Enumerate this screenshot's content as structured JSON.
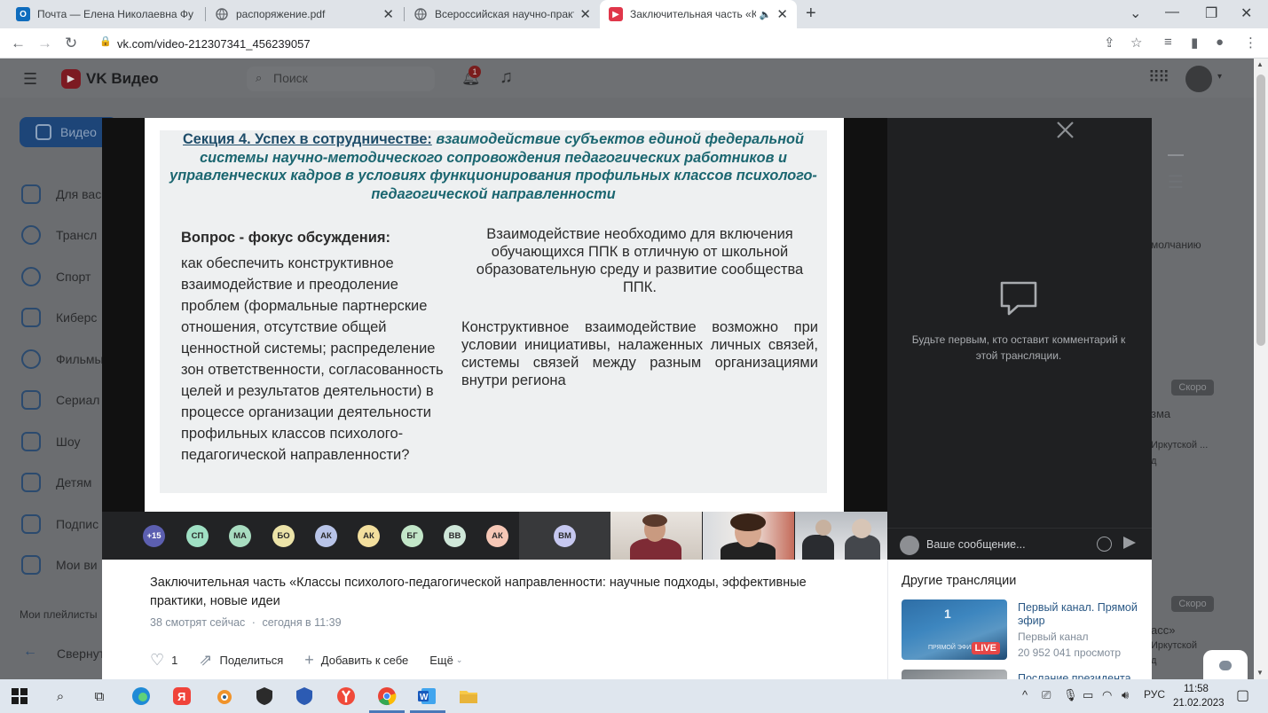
{
  "browser": {
    "tabs": [
      {
        "title": "Почта — Елена Николаевна Фу",
        "favicon": "O"
      },
      {
        "title": "распоряжение.pdf",
        "favicon": ""
      },
      {
        "title": "Всероссийская научно-практич",
        "favicon": ""
      },
      {
        "title": "Заключительная часть «Кла",
        "favicon": ""
      }
    ],
    "url": "vk.com/video-212307341_456239057"
  },
  "vk": {
    "logo_text": "VK Видео",
    "search_placeholder": "Поиск",
    "notif_count": "1",
    "sidebar": {
      "video_button": "Видео",
      "items": [
        {
          "label": "Для вас"
        },
        {
          "label": "Трансл"
        },
        {
          "label": "Спорт"
        },
        {
          "label": "Киберс"
        },
        {
          "label": "Фильмы"
        },
        {
          "label": "Сериал"
        },
        {
          "label": "Шоу"
        },
        {
          "label": "Детям"
        },
        {
          "label": "Подпис"
        },
        {
          "label": "Мои ви"
        }
      ],
      "playlists_caption": "Мои плейлисты",
      "collapse_label": "Свернут"
    },
    "right_ghost": {
      "sort_label": "молчанию",
      "soon1": "Скоро",
      "t1": "зма",
      "t1b": "Иркутской ...",
      "t1c": "д",
      "soon2": "Скоро",
      "t2": "асс»",
      "t2b": "Иркутской",
      "t2c": "д"
    }
  },
  "slide": {
    "section_label": "Секция 4. Успех в сотрудничестве:",
    "title_rest": "взаимодействие субъектов единой федеральной системы научно-методического сопровождения педагогических работников и управленческих кадров в условиях функционирования профильных классов психолого-педагогической направленности",
    "question_head": "Вопрос - фокус обсуждения:",
    "question_body": "как обеспечить конструктивное взаимодействие и преодоление проблем (формальные партнерские отношения, отсутствие общей ценностной системы; распределение зон ответственности, согласованность целей и результатов деятельности) в процессе организации деятельности профильных классов психолого-педагогической направленности?",
    "right_p1": "Взаимодействие необходимо для включения обучающихся ППК в отличную от школьной образовательную среду и развитие сообщества ППК.",
    "right_p2": "Конструктивное взаимодействие возможно при условии инициативы, налаженных личных связей, системы связей между разным организациями внутри региона"
  },
  "participants": [
    {
      "initials": "+15",
      "color": "#5c5fb0"
    },
    {
      "initials": "СП",
      "color": "#9fe0c4"
    },
    {
      "initials": "МА",
      "color": "#a8dcc0"
    },
    {
      "initials": "БО",
      "color": "#ece3a8"
    },
    {
      "initials": "АК",
      "color": "#b8c4e8"
    },
    {
      "initials": "АК",
      "color": "#f3df9e"
    },
    {
      "initials": "БГ",
      "color": "#c2e6c8"
    },
    {
      "initials": "ВВ",
      "color": "#cfe7d9"
    },
    {
      "initials": "АК",
      "color": "#f6c7b6"
    },
    {
      "initials": "ВМ",
      "color": "#c6c8f0"
    }
  ],
  "chat": {
    "empty_text": "Будьте первым, кто оставит комментарий к этой трансляции.",
    "input_placeholder": "Ваше сообщение..."
  },
  "video": {
    "title": "Заключительная часть «Классы психолого-педагогической направленности: научные подходы, эффективные практики, новые идеи",
    "watching": "38 смотрят сейчас",
    "dot": "·",
    "started": "сегодня в 11:39",
    "likes": "1",
    "share": "Поделиться",
    "add": "Добавить к себе",
    "more": "Ещё"
  },
  "others": {
    "heading": "Другие трансляции",
    "items": [
      {
        "title": "Первый канал. Прямой эфир",
        "channel": "Первый канал",
        "views": "20 952 041 просмотр",
        "badge": "LIVE",
        "thumb_text": "ПРЯМОЙ ЭФИР"
      },
      {
        "title": "Послание президента"
      }
    ]
  },
  "taskbar": {
    "lang": "РУС",
    "time": "11:58",
    "date": "21.02.2023"
  }
}
